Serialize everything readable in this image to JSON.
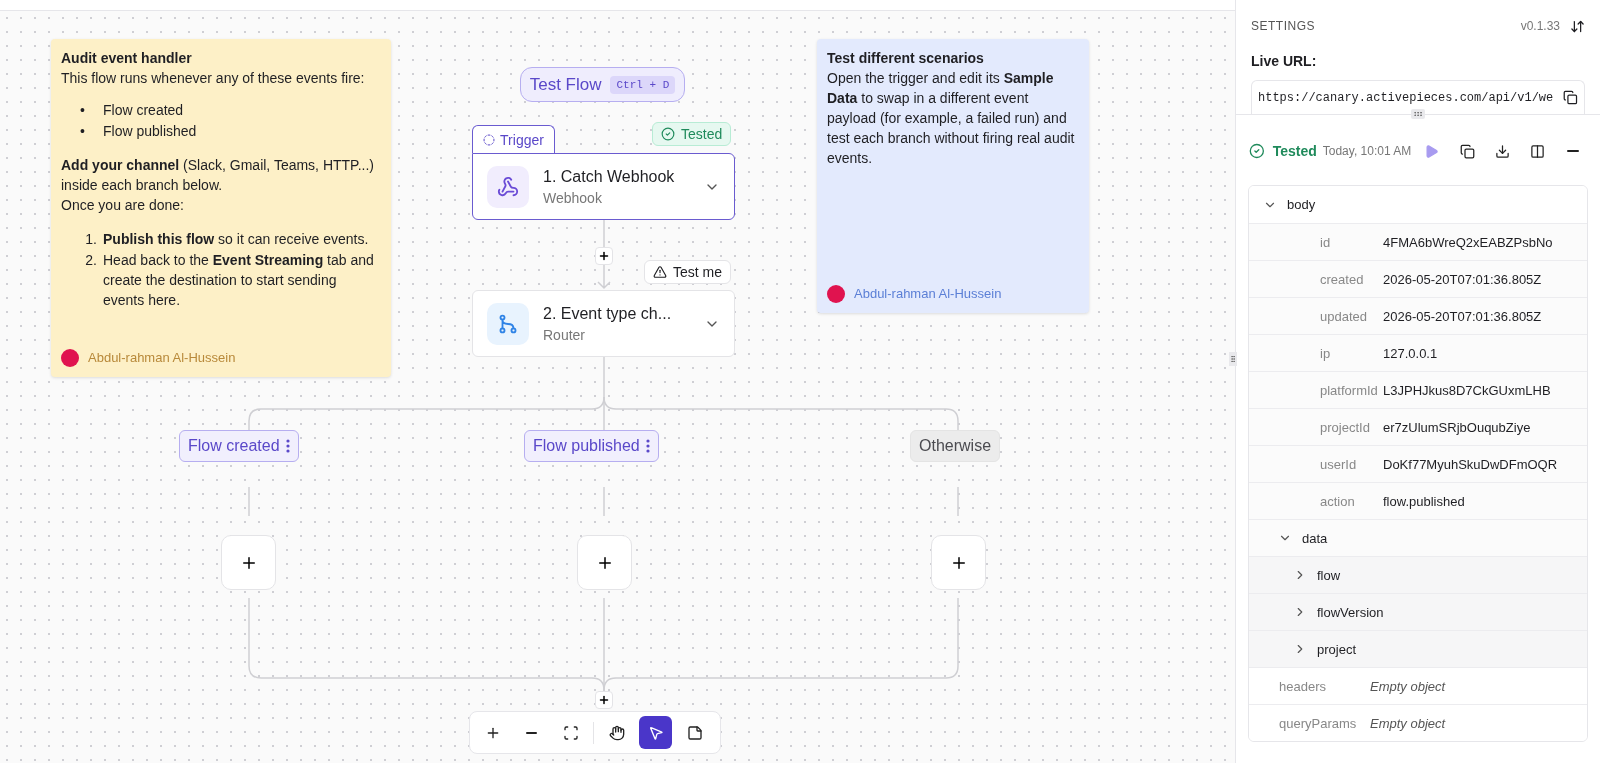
{
  "canvas": {
    "notes": [
      {
        "color": "#fdf0c7",
        "title": "Audit event handler",
        "blocks": [
          {
            "kind": "text",
            "text": "This flow runs whenever any of these events fire:"
          },
          {
            "kind": "bullets",
            "items": [
              {
                "marker": "•",
                "text": "Flow created"
              },
              {
                "marker": "•",
                "text": "Flow published"
              }
            ]
          },
          {
            "kind": "text",
            "text": "**Add your channel** (Slack, Gmail, Teams, HTTP...) inside each branch below."
          },
          {
            "kind": "text",
            "text": "Once you are done:"
          },
          {
            "kind": "numbered",
            "items": [
              {
                "marker": "1.",
                "text": "**Publish this flow** so it can receive events."
              },
              {
                "marker": "2.",
                "text": "Head back to the **Event Streaming** tab and create the destination to start sending events here."
              }
            ]
          }
        ],
        "author": "Abdul-rahman Al-Hussein"
      },
      {
        "color": "#e3eafd",
        "title": "Test different scenarios",
        "blocks": [
          {
            "kind": "text",
            "text": "Open the trigger and edit its **Sample Data** to swap in a different event payload (for example, a failed run) and test each branch without firing real audit events."
          }
        ],
        "author": "Abdul-rahman Al-Hussein"
      }
    ],
    "test_flow": {
      "label": "Test Flow",
      "shortcut": "Ctrl + D"
    },
    "steps": [
      {
        "tab": "Trigger",
        "status": {
          "kind": "tested",
          "label": "Tested"
        },
        "title": "1. Catch Webhook",
        "subtitle": "Webhook",
        "kind": "webhook",
        "selected": true
      },
      {
        "status": {
          "kind": "warning",
          "label": "Test me"
        },
        "title": "2. Event type ch...",
        "subtitle": "Router",
        "kind": "router",
        "selected": false
      }
    ],
    "branches": [
      {
        "label": "Flow created",
        "kind": "condition"
      },
      {
        "label": "Flow published",
        "kind": "condition"
      },
      {
        "label": "Otherwise",
        "kind": "fallback"
      }
    ],
    "toolbar": [
      {
        "kind": "zoom-in",
        "selected": false
      },
      {
        "kind": "zoom-out",
        "selected": false
      },
      {
        "kind": "fit",
        "selected": false
      },
      {
        "kind": "hand",
        "selected": false
      },
      {
        "kind": "pointer",
        "selected": true
      },
      {
        "kind": "note",
        "selected": false
      }
    ]
  },
  "panel": {
    "heading": "SETTINGS",
    "version": "v0.1.33",
    "live_url_label": "Live URL:",
    "live_url": "https://canary.activepieces.com/api/v1/we",
    "test_result": {
      "status": "Tested",
      "time": "Today, 10:01 AM"
    },
    "output": [
      {
        "key": "body",
        "expanded": true,
        "children": [
          {
            "key": "id",
            "value": "4FMA6bWreQ2xEABZPsbNo"
          },
          {
            "key": "created",
            "value": "2026-05-20T07:01:36.805Z"
          },
          {
            "key": "updated",
            "value": "2026-05-20T07:01:36.805Z"
          },
          {
            "key": "ip",
            "value": "127.0.0.1"
          },
          {
            "key": "platformId",
            "value": "L3JPHJkus8D7CkGUxmLHB"
          },
          {
            "key": "projectId",
            "value": "er7zUlumSRjbOuqubZiye"
          },
          {
            "key": "userId",
            "value": "DoKf77MyuhSkuDwDFmOQR"
          },
          {
            "key": "action",
            "value": "flow.published"
          },
          {
            "key": "data",
            "expanded": true,
            "children": [
              {
                "key": "flow",
                "expanded": false
              },
              {
                "key": "flowVersion",
                "expanded": false
              },
              {
                "key": "project",
                "expanded": false
              }
            ]
          }
        ]
      },
      {
        "key": "headers",
        "value": "Empty object",
        "kind": "empty"
      },
      {
        "key": "queryParams",
        "value": "Empty object",
        "kind": "empty"
      }
    ]
  }
}
